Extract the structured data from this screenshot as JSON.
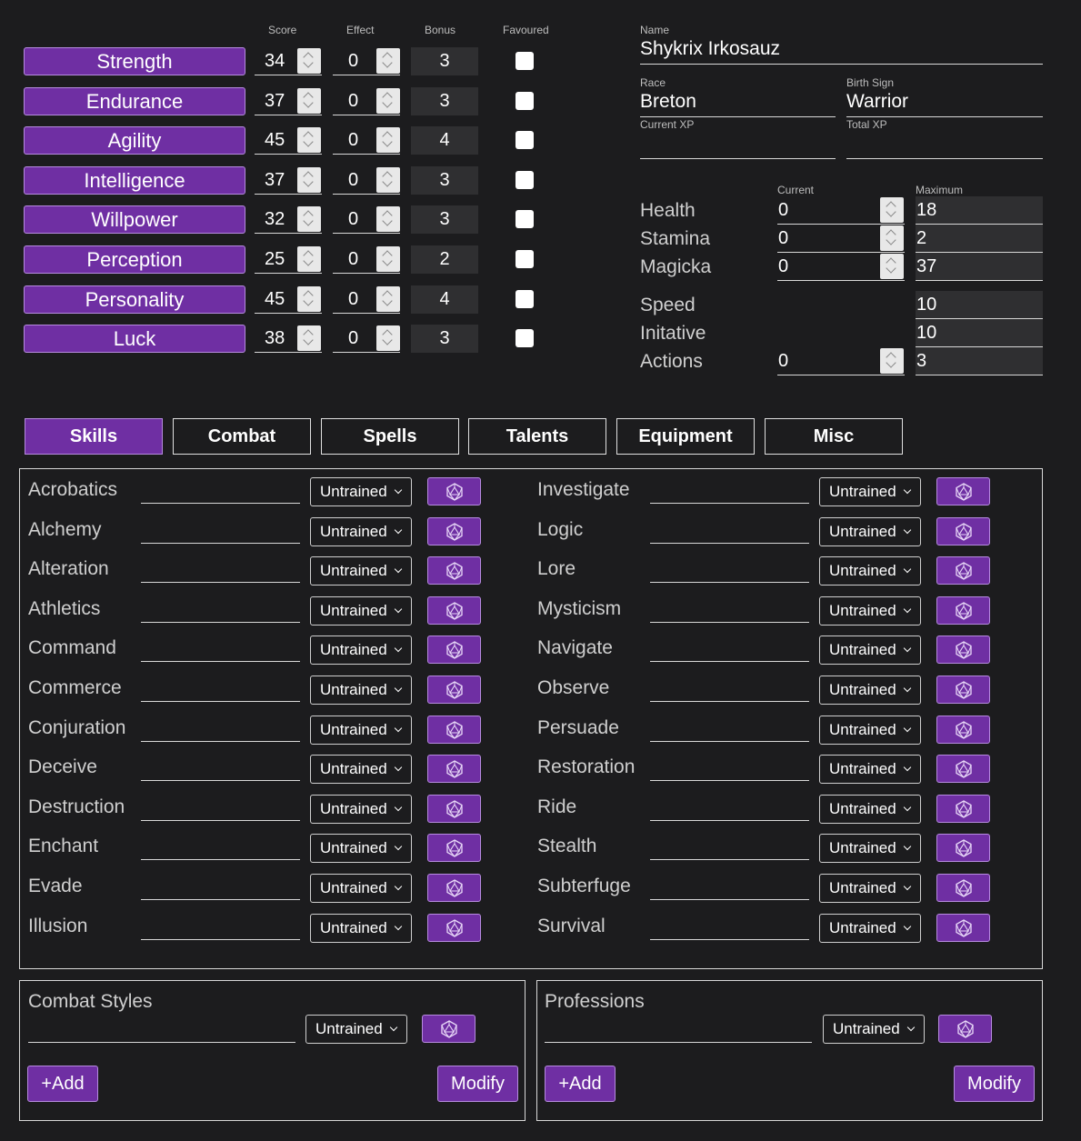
{
  "headers": {
    "score": "Score",
    "effect": "Effect",
    "bonus": "Bonus",
    "favoured": "Favoured"
  },
  "attributes": [
    {
      "name": "Strength",
      "score": "34",
      "effect": "0",
      "bonus": "3"
    },
    {
      "name": "Endurance",
      "score": "37",
      "effect": "0",
      "bonus": "3"
    },
    {
      "name": "Agility",
      "score": "45",
      "effect": "0",
      "bonus": "4"
    },
    {
      "name": "Intelligence",
      "score": "37",
      "effect": "0",
      "bonus": "3"
    },
    {
      "name": "Willpower",
      "score": "32",
      "effect": "0",
      "bonus": "3"
    },
    {
      "name": "Perception",
      "score": "25",
      "effect": "0",
      "bonus": "2"
    },
    {
      "name": "Personality",
      "score": "45",
      "effect": "0",
      "bonus": "4"
    },
    {
      "name": "Luck",
      "score": "38",
      "effect": "0",
      "bonus": "3"
    }
  ],
  "character": {
    "name_label": "Name",
    "name": "Shykrix Irkosauz",
    "race_label": "Race",
    "race": "Breton",
    "birthsign_label": "Birth Sign",
    "birthsign": "Warrior",
    "current_xp_label": "Current XP",
    "current_xp": "",
    "total_xp_label": "Total XP",
    "total_xp": ""
  },
  "vitals": {
    "current_label": "Current",
    "maximum_label": "Maximum",
    "health_label": "Health",
    "health_current": "0",
    "health_max": "18",
    "stamina_label": "Stamina",
    "stamina_current": "0",
    "stamina_max": "2",
    "magicka_label": "Magicka",
    "magicka_current": "0",
    "magicka_max": "37",
    "speed_label": "Speed",
    "speed": "10",
    "initiative_label": "Initative",
    "initiative": "10",
    "actions_label": "Actions",
    "actions_current": "0",
    "actions_max": "3"
  },
  "tabs": [
    "Skills",
    "Combat",
    "Spells",
    "Talents",
    "Equipment",
    "Misc"
  ],
  "skills_left": [
    "Acrobatics",
    "Alchemy",
    "Alteration",
    "Athletics",
    "Command",
    "Commerce",
    "Conjuration",
    "Deceive",
    "Destruction",
    "Enchant",
    "Evade",
    "Illusion"
  ],
  "skills_right": [
    "Investigate",
    "Logic",
    "Lore",
    "Mysticism",
    "Navigate",
    "Observe",
    "Persuade",
    "Restoration",
    "Ride",
    "Stealth",
    "Subterfuge",
    "Survival"
  ],
  "skill_level": "Untrained",
  "combat_styles": {
    "title": "Combat Styles",
    "level": "Untrained",
    "add": "+Add",
    "modify": "Modify"
  },
  "professions": {
    "title": "Professions",
    "level": "Untrained",
    "add": "+Add",
    "modify": "Modify"
  },
  "colors": {
    "accent": "#6f2fa3",
    "background": "#1c1c1e"
  }
}
